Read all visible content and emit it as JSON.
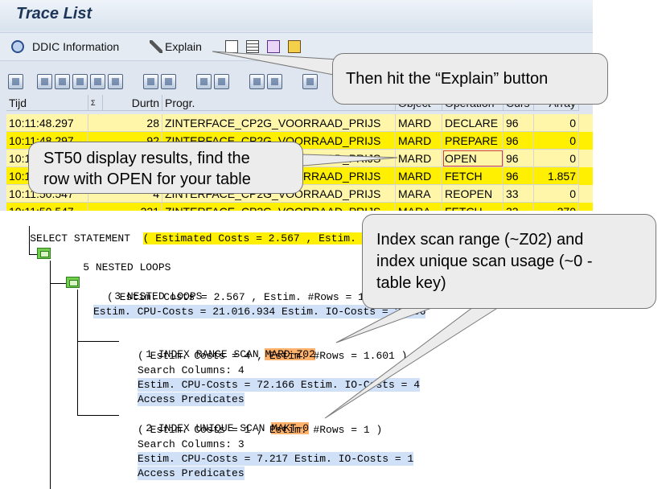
{
  "window": {
    "title": "Trace List"
  },
  "app_toolbar": {
    "ddic_label": "DDIC Information",
    "explain_label": "Explain"
  },
  "grid": {
    "headers": {
      "time": "Tijd",
      "sigma": "Σ",
      "duration": "Durtn",
      "program": "Progr.",
      "object": "Object",
      "operation": "Operation",
      "curs": "Curs",
      "array": "Array"
    },
    "rows": [
      {
        "time": "10:11:48.297",
        "duration": "28",
        "program": "ZINTERFACE_CP2G_VOORRAAD_PRIJS",
        "object": "MARD",
        "operation": "DECLARE",
        "curs": "96",
        "array": "0"
      },
      {
        "time": "10:11:48.297",
        "duration": "92",
        "program": "ZINTERFACE_CP2G_VOORRAAD_PRIJS",
        "object": "MARD",
        "operation": "PREPARE",
        "curs": "96",
        "array": "0"
      },
      {
        "time": "10:11:48.297",
        "duration": "",
        "program": "ZINTERFACE_CP2G_VOORRAAD_PRIJS",
        "object": "MARD",
        "operation": "OPEN",
        "curs": "96",
        "array": "0"
      },
      {
        "time": "10:11:48.297",
        "duration": "",
        "program": "ZINTERFACE_CP2G_VOORRAAD_PRIJS",
        "object": "MARD",
        "operation": "FETCH",
        "curs": "96",
        "array": "1.857"
      },
      {
        "time": "10:11:50.547",
        "duration": "4",
        "program": "ZINTERFACE_CP2G_VOORRAAD_PRIJS",
        "object": "MARA",
        "operation": "REOPEN",
        "curs": "33",
        "array": "0"
      },
      {
        "time": "10:11:50.547",
        "duration": "221",
        "program": "ZINTERFACE_CP2G_VOORRAAD_PRIJS",
        "object": "MARA",
        "operation": "FETCH",
        "curs": "33",
        "array": "270"
      }
    ]
  },
  "plan": {
    "select": "SELECT STATEMENT",
    "select_cost": "( Estimated Costs = 2.567 , Estim. #Rows = 1.601 )",
    "n5": "5",
    "n5_label": "NESTED LOOPS",
    "n3": "3",
    "n3_label": "NESTED LOOPS",
    "n3_l1": "( Estim. Costs = 2.567 , Estim. #Rows = 1.601 )",
    "n3_l2": "Estim. CPU-Costs = 21.016.934 Estim. IO-Costs = 2.566",
    "n1": "1",
    "n1_label": "INDEX RANGE SCAN",
    "n1_index": "MARD~Z02",
    "n1_l1": "( Estim. Costs = 4 , Estim. #Rows = 1.601 )",
    "n1_l2": "Search Columns: 4",
    "n1_l3": "Estim. CPU-Costs = 72.166 Estim. IO-Costs = 4",
    "n1_l4": "Access Predicates",
    "n2": "2",
    "n2_label": "INDEX UNIQUE SCAN",
    "n2_index": "MAKT~0",
    "n2_l1": "( Estim. Costs = 1 , Estim. #Rows = 1 )",
    "n2_l2": "Search Columns: 3",
    "n2_l3": "Estim. CPU-Costs = 7.217 Estim. IO-Costs = 1",
    "n2_l4": "Access Predicates"
  },
  "callouts": {
    "explain": "Then hit the “Explain” button",
    "st50_line1": "ST50 display results, find the",
    "st50_line2": "row with OPEN for your table",
    "index_line1": "Index scan range (~Z02) and",
    "index_line2": "index unique scan usage (~0 -",
    "index_line3": "table key)"
  },
  "colors": {
    "row_yellow_light": "#fff6a9",
    "row_yellow": "#ffef00",
    "index_highlight": "#ffb26b",
    "predicate_highlight": "#cfe0f7",
    "node_icon": "#6fcf4a"
  }
}
